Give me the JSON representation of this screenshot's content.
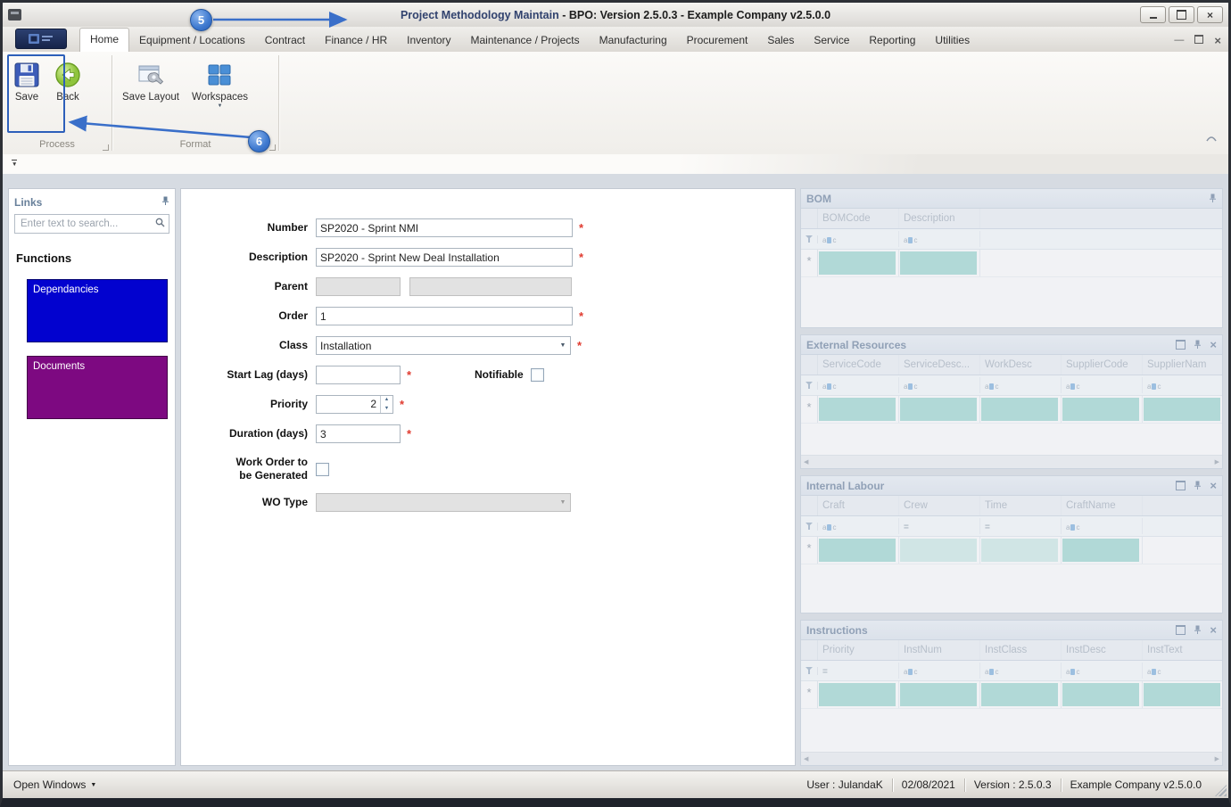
{
  "window": {
    "title_main": "Project Methodology Maintain",
    "title_rest": " - BPO: Version 2.5.0.3 - Example Company v2.5.0.0"
  },
  "ribbon": {
    "tabs": [
      "Home",
      "Equipment / Locations",
      "Contract",
      "Finance / HR",
      "Inventory",
      "Maintenance / Projects",
      "Manufacturing",
      "Procurement",
      "Sales",
      "Service",
      "Reporting",
      "Utilities"
    ],
    "active_tab": "Home",
    "buttons": {
      "save": "Save",
      "back": "Back",
      "save_layout": "Save Layout",
      "workspaces": "Workspaces"
    },
    "groups": {
      "process": "Process",
      "format": "Format"
    }
  },
  "callouts": {
    "step5": "5",
    "step6": "6"
  },
  "links_panel": {
    "title": "Links",
    "search_placeholder": "Enter text to search...",
    "heading": "Functions",
    "items": [
      {
        "label": "Dependancies",
        "color": "#0202cf"
      },
      {
        "label": "Documents",
        "color": "#7d0981"
      }
    ]
  },
  "form": {
    "required_marker": "*",
    "number": {
      "label": "Number",
      "value": "SP2020 - Sprint NMI"
    },
    "description": {
      "label": "Description",
      "value": "SP2020 - Sprint New Deal Installation"
    },
    "parent": {
      "label": "Parent",
      "value1": "",
      "value2": ""
    },
    "order": {
      "label": "Order",
      "value": "1"
    },
    "class": {
      "label": "Class",
      "value": "Installation"
    },
    "start_lag": {
      "label": "Start Lag (days)",
      "value": ""
    },
    "notifiable": {
      "label": "Notifiable",
      "checked": false
    },
    "priority": {
      "label": "Priority",
      "value": "2"
    },
    "duration": {
      "label": "Duration (days)",
      "value": "3"
    },
    "wo_generate": {
      "label": "Work Order to\nbe Generated",
      "checked": false
    },
    "wo_type": {
      "label": "WO Type",
      "value": ""
    }
  },
  "grids": [
    {
      "id": "bom",
      "title": "BOM",
      "columns": [
        "BOMCode",
        "Description"
      ],
      "filters": [
        "abc",
        "abc"
      ],
      "new_cells": [
        "t",
        "t"
      ],
      "controls": false,
      "hscroll": false
    },
    {
      "id": "external-resources",
      "title": "External Resources",
      "columns": [
        "ServiceCode",
        "ServiceDesc...",
        "WorkDesc",
        "SupplierCode",
        "SupplierNam"
      ],
      "filters": [
        "abc",
        "abc",
        "abc",
        "abc",
        "abc"
      ],
      "new_cells": [
        "t",
        "t",
        "t",
        "t",
        "t"
      ],
      "controls": true,
      "hscroll": true
    },
    {
      "id": "internal-labour",
      "title": "Internal Labour",
      "columns": [
        "Craft",
        "Crew",
        "Time",
        "CraftName"
      ],
      "filters": [
        "abc",
        "eq",
        "eq",
        "abc"
      ],
      "new_cells": [
        "t",
        "l",
        "l",
        "t"
      ],
      "controls": true,
      "hscroll": false
    },
    {
      "id": "instructions",
      "title": "Instructions",
      "columns": [
        "Priority",
        "InstNum",
        "InstClass",
        "InstDesc",
        "InstText"
      ],
      "filters": [
        "eq",
        "abc",
        "abc",
        "abc",
        "abc"
      ],
      "new_cells": [
        "t",
        "t",
        "t",
        "t",
        "t"
      ],
      "controls": true,
      "hscroll": true
    }
  ],
  "statusbar": {
    "open_windows": "Open Windows",
    "segments": [
      "User : JulandaK",
      "02/08/2021",
      "Version : 2.5.0.3",
      "Example Company v2.5.0.0"
    ]
  }
}
